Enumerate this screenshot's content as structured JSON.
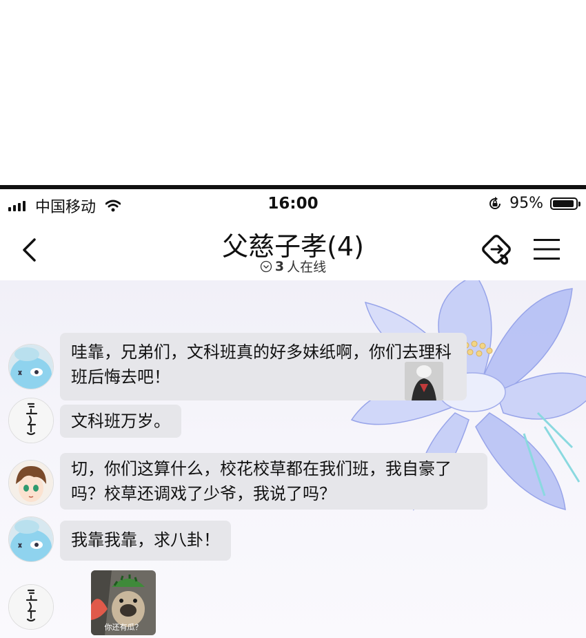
{
  "status_bar": {
    "carrier": "中国移动",
    "time": "16:00",
    "battery": "95%",
    "battery_level": 0.95,
    "wifi_icon": "wifi-icon",
    "signal_icon": "signal-bars-icon",
    "rotation_lock_icon": "rotation-lock-icon"
  },
  "nav": {
    "title": "父慈子孝(4)",
    "online_count": "3",
    "online_text": "人在线",
    "back_icon": "chevron-left-icon",
    "plugin_icon": "group-plugin-icon",
    "menu_icon": "hamburger-menu-icon"
  },
  "messages": [
    {
      "avatar": "avatar-blue-mascot",
      "text": "哇靠，兄弟们，文科班真的好多妹纸啊，你们去理科班后悔去吧！",
      "sticker": true
    },
    {
      "avatar": "avatar-calligraphy",
      "text": "文科班万岁。"
    },
    {
      "avatar": "avatar-anime-boy",
      "text": "切，你们这算什么，校花校草都在我们班，我自豪了吗？校草还调戏了少爷，我说了吗？"
    },
    {
      "avatar": "avatar-blue-mascot",
      "text": "我靠我靠，求八卦！"
    },
    {
      "avatar": "avatar-calligraphy",
      "image": true,
      "image_caption": "你还有瓜？"
    }
  ],
  "colors": {
    "bubble": "#e6e6ea",
    "text": "#111111",
    "chat_bg": "#f3f2f9",
    "flower": "#a9b6f2"
  }
}
